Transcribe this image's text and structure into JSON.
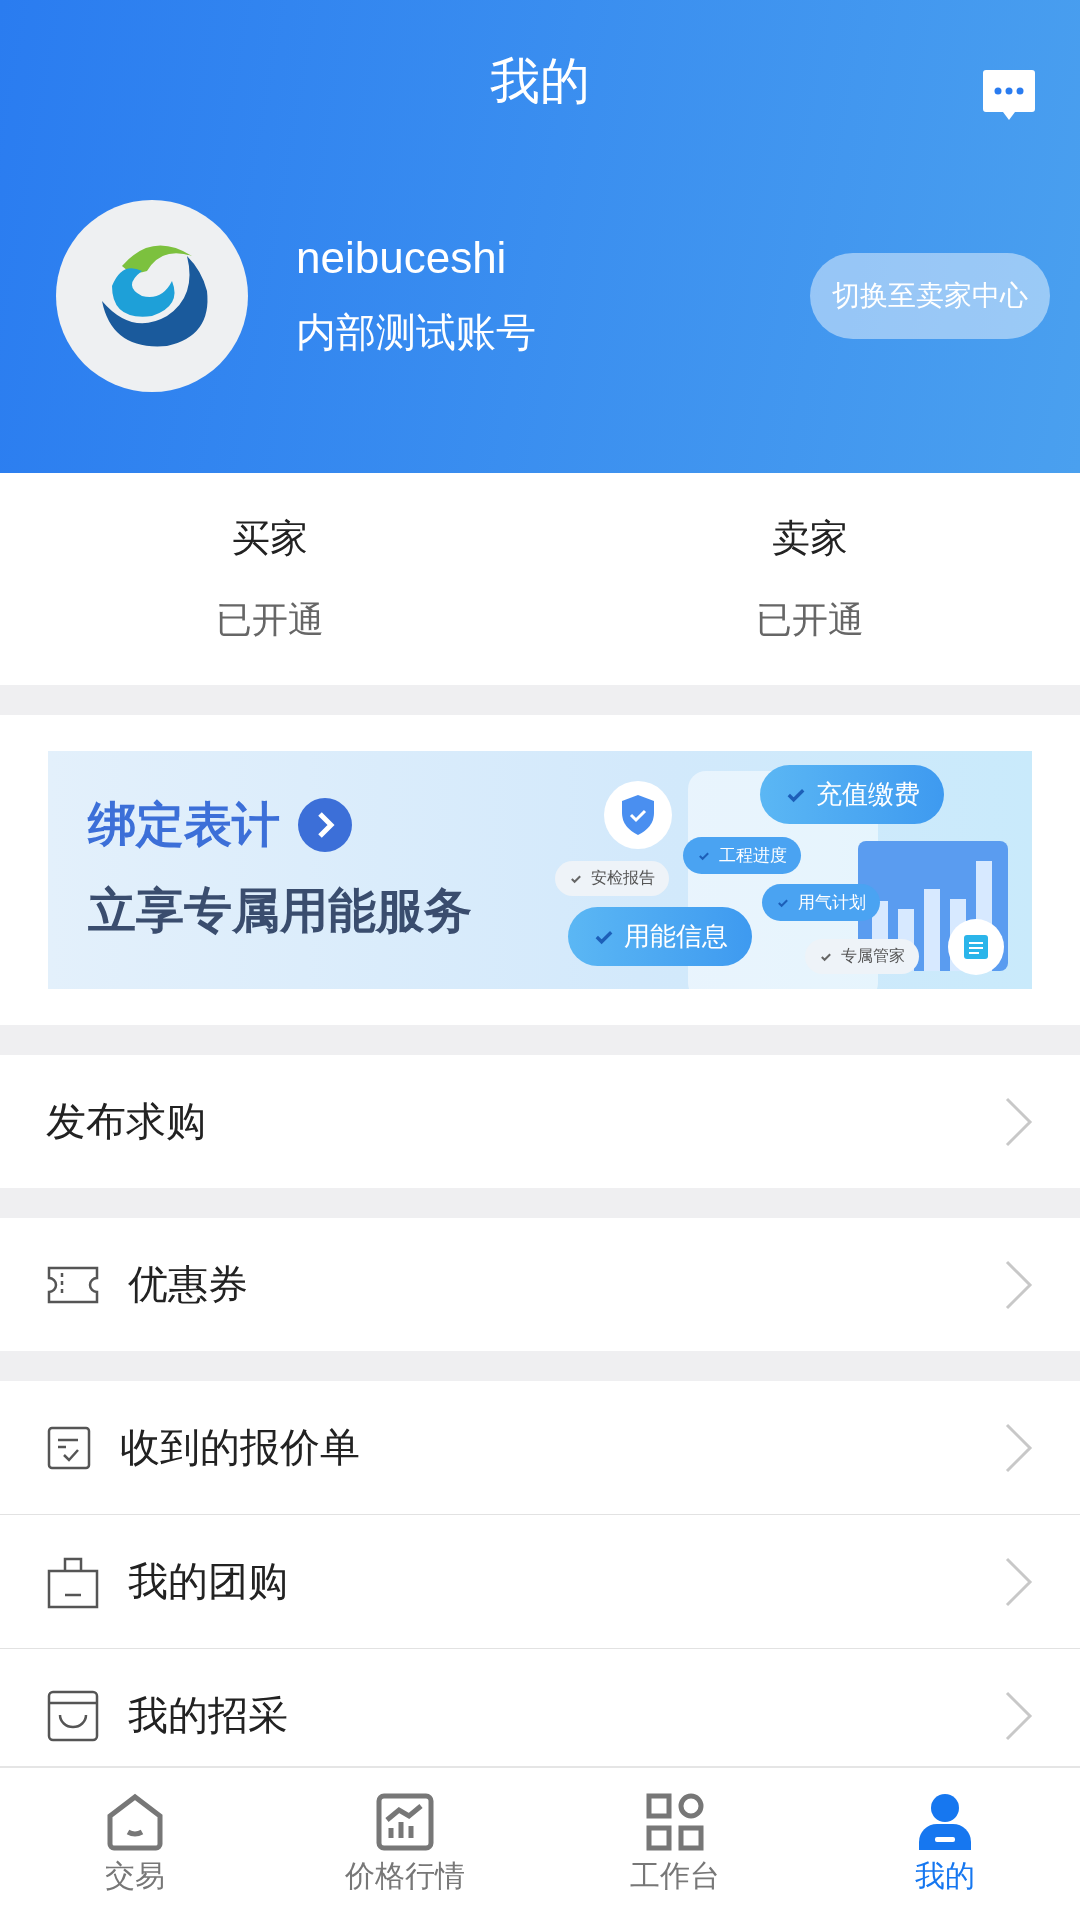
{
  "header": {
    "title": "我的",
    "username": "neibuceshi",
    "account_label": "内部测试账号",
    "switch_button": "切换至卖家中心"
  },
  "roles": [
    {
      "name": "买家",
      "status": "已开通"
    },
    {
      "name": "卖家",
      "status": "已开通"
    }
  ],
  "banner": {
    "headline": "绑定表计",
    "subline": "立享专属用能服务",
    "chips": [
      {
        "label": "充值缴费",
        "kind": "large"
      },
      {
        "label": "工程进度",
        "kind": "medium"
      },
      {
        "label": "安检报告",
        "kind": "plain"
      },
      {
        "label": "用气计划",
        "kind": "medium"
      },
      {
        "label": "用能信息",
        "kind": "large"
      },
      {
        "label": "专属管家",
        "kind": "plain"
      }
    ]
  },
  "menu_groups": [
    {
      "items": [
        {
          "label": "发布求购",
          "kind": "plain"
        }
      ]
    },
    {
      "items": [
        {
          "label": "优惠券",
          "kind": "ticket"
        }
      ]
    },
    {
      "items": [
        {
          "label": "收到的报价单",
          "kind": "quote"
        },
        {
          "label": "我的团购",
          "kind": "bag"
        },
        {
          "label": "我的招采",
          "kind": "tray"
        }
      ]
    }
  ],
  "tab_bar": [
    {
      "label": "交易",
      "kind": "home",
      "selected": false
    },
    {
      "label": "价格行情",
      "kind": "chart",
      "selected": false
    },
    {
      "label": "工作台",
      "kind": "grid",
      "selected": false
    },
    {
      "label": "我的",
      "kind": "person",
      "selected": true
    }
  ]
}
